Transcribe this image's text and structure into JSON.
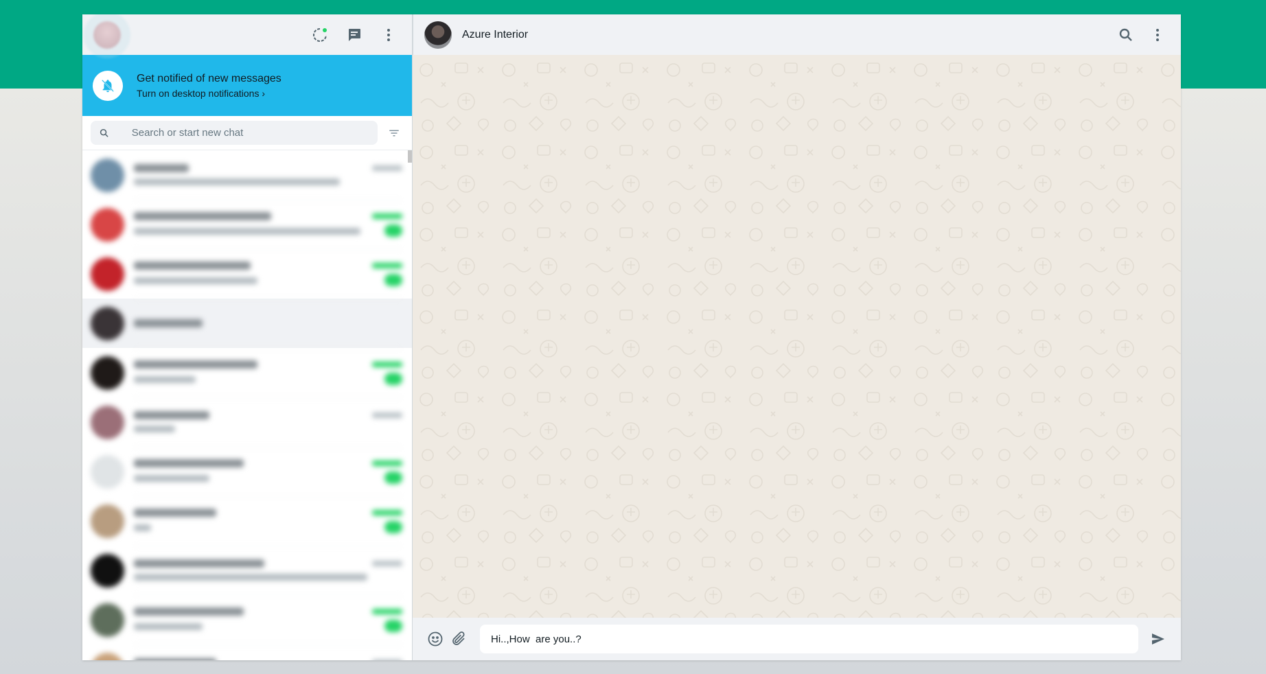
{
  "notification": {
    "title": "Get notified of new messages",
    "subtitle": "Turn on desktop notifications ›"
  },
  "search": {
    "placeholder": "Search or start new chat"
  },
  "chat": {
    "contact_name": "Azure Interior",
    "message_value": "Hi..,How  are you..?"
  },
  "chat_list": [
    {
      "avatar": "#6f8fa8",
      "name_w": 80,
      "msg_w": 300,
      "time": "gray",
      "badge": false,
      "active": false
    },
    {
      "avatar": "#d84646",
      "name_w": 200,
      "msg_w": 330,
      "time": "green",
      "badge": true,
      "active": false
    },
    {
      "avatar": "#c3232a",
      "name_w": 170,
      "msg_w": 180,
      "time": "green",
      "badge": true,
      "active": false
    },
    {
      "avatar": "#3a3437",
      "name_w": 100,
      "msg_w": 0,
      "time": "none",
      "badge": false,
      "active": true
    },
    {
      "avatar": "#1f1a18",
      "name_w": 180,
      "msg_w": 90,
      "time": "green",
      "badge": true,
      "active": false
    },
    {
      "avatar": "#9b6f78",
      "name_w": 110,
      "msg_w": 60,
      "time": "gray",
      "badge": false,
      "active": false
    },
    {
      "avatar": "#e0e4e6",
      "name_w": 160,
      "msg_w": 110,
      "time": "green",
      "badge": true,
      "active": false
    },
    {
      "avatar": "#b89d80",
      "name_w": 120,
      "msg_w": 25,
      "time": "green",
      "badge": true,
      "active": false
    },
    {
      "avatar": "#101010",
      "name_w": 190,
      "msg_w": 340,
      "time": "gray",
      "badge": false,
      "active": false
    },
    {
      "avatar": "#5e6e5c",
      "name_w": 160,
      "msg_w": 100,
      "time": "green",
      "badge": true,
      "active": false
    },
    {
      "avatar": "#c9a27a",
      "name_w": 120,
      "msg_w": 200,
      "time": "gray",
      "badge": false,
      "active": false
    }
  ]
}
